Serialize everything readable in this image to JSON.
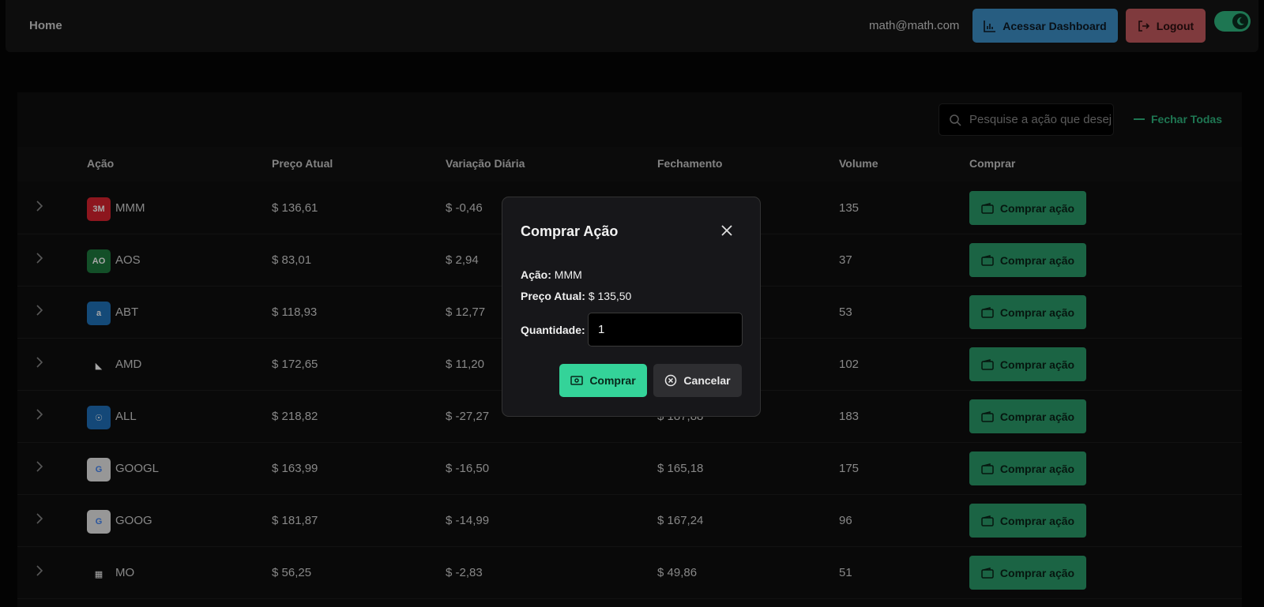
{
  "navbar": {
    "home": "Home",
    "email": "math@math.com",
    "dashboard_label": "Acessar Dashboard",
    "logout_label": "Logout",
    "colors": {
      "dashboard": "#3d8fc7",
      "logout": "#c45a5e",
      "toggle": "#2fb57f"
    }
  },
  "toolbar": {
    "search_placeholder": "Pesquise a ação que deseja",
    "collapse_all_label": "Fechar Todas"
  },
  "table": {
    "headers": {
      "acao": "Ação",
      "preco": "Preço Atual",
      "variacao": "Variação Diária",
      "fechamento": "Fechamento",
      "volume": "Volume",
      "comprar": "Comprar"
    },
    "buy_label": "Comprar ação",
    "rows": [
      {
        "symbol": "MMM",
        "logo": "3M",
        "logo_color": "#d9232f",
        "price": "$ 136,61",
        "variation": "$ -0,46",
        "close": "",
        "volume": "135"
      },
      {
        "symbol": "AOS",
        "logo": "AO",
        "logo_color": "#1e7a3e",
        "price": "$ 83,01",
        "variation": "$ 2,94",
        "close": "",
        "volume": "37"
      },
      {
        "symbol": "ABT",
        "logo": "a",
        "logo_color": "#1f72b8",
        "price": "$ 118,93",
        "variation": "$ 12,77",
        "close": "",
        "volume": "53"
      },
      {
        "symbol": "AMD",
        "logo": "◣",
        "logo_color": "#0f0f0f",
        "price": "$ 172,65",
        "variation": "$ 11,20",
        "close": "",
        "volume": "102"
      },
      {
        "symbol": "ALL",
        "logo": "☉",
        "logo_color": "#1f6fb8",
        "price": "$ 218,82",
        "variation": "$ -27,27",
        "close": "$ 187,88",
        "volume": "183"
      },
      {
        "symbol": "GOOGL",
        "logo": "G",
        "logo_color": "#e8e8e8",
        "price": "$ 163,99",
        "variation": "$ -16,50",
        "close": "$ 165,18",
        "volume": "175"
      },
      {
        "symbol": "GOOG",
        "logo": "G",
        "logo_color": "#e8e8e8",
        "price": "$ 181,87",
        "variation": "$ -14,99",
        "close": "$ 167,24",
        "volume": "96"
      },
      {
        "symbol": "MO",
        "logo": "▦",
        "logo_color": "#0f0f0f",
        "price": "$ 56,25",
        "variation": "$ -2,83",
        "close": "$ 49,86",
        "volume": "51"
      }
    ]
  },
  "modal": {
    "title": "Comprar Ação",
    "acao_label": "Ação:",
    "acao_value": "MMM",
    "preco_label": "Preço Atual:",
    "preco_value": "$ 135,50",
    "qty_label": "Quantidade:",
    "qty_value": "1",
    "confirm_label": "Comprar",
    "cancel_label": "Cancelar"
  }
}
